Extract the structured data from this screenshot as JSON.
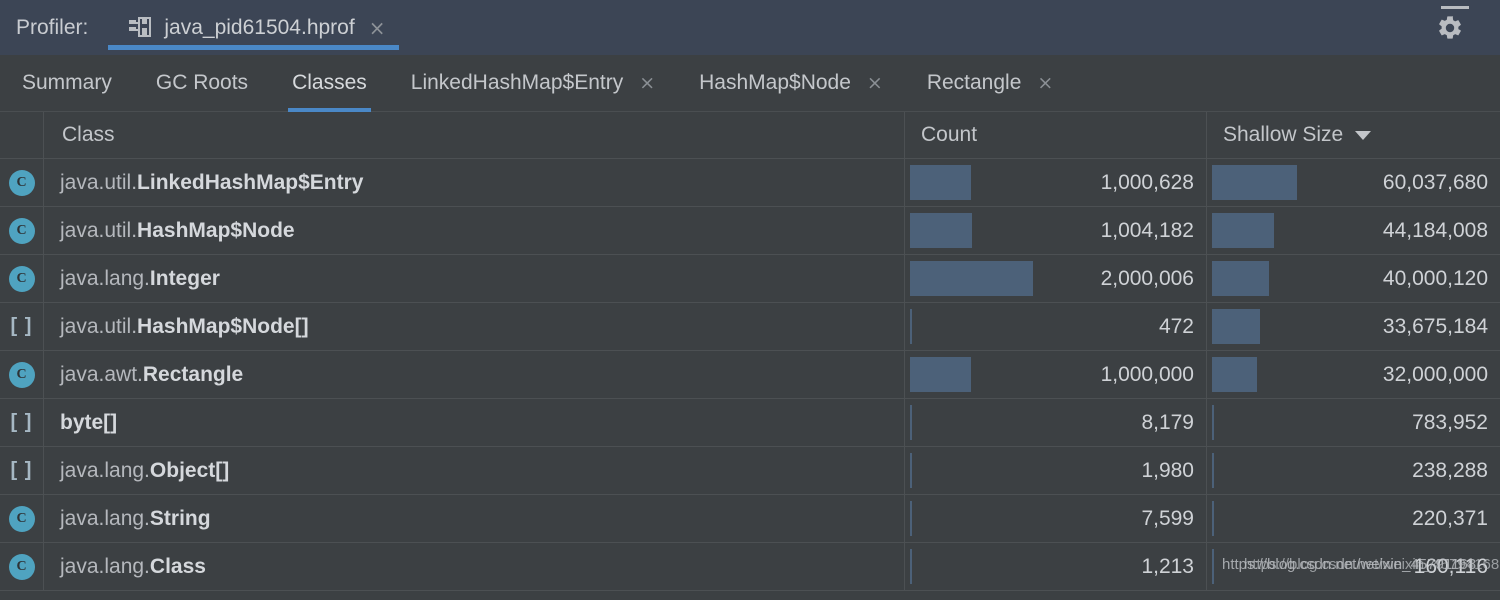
{
  "titlebar": {
    "profiler_label": "Profiler:",
    "file_tab": {
      "icon": "hprof-file-icon",
      "title": "java_pid61504.hprof",
      "close": "×"
    },
    "controls": {
      "settings_icon": "gear-icon",
      "minimize_icon": "minimize-icon"
    },
    "accent_color": "#4a88c7",
    "background_color": "#3c4555"
  },
  "tabs": [
    {
      "label": "Summary",
      "active": false,
      "closable": false,
      "close": ""
    },
    {
      "label": "GC Roots",
      "active": false,
      "closable": false,
      "close": ""
    },
    {
      "label": "Classes",
      "active": true,
      "closable": false,
      "close": ""
    },
    {
      "label": "LinkedHashMap$Entry",
      "active": false,
      "closable": true,
      "close": "×"
    },
    {
      "label": "HashMap$Node",
      "active": false,
      "closable": true,
      "close": "×"
    },
    {
      "label": "Rectangle",
      "active": false,
      "closable": true,
      "close": "×"
    }
  ],
  "table": {
    "columns": [
      {
        "key": "icon",
        "label": ""
      },
      {
        "key": "class",
        "label": "Class"
      },
      {
        "key": "count",
        "label": "Count"
      },
      {
        "key": "size",
        "label": "Shallow Size",
        "sorted": "desc",
        "caret": "▼"
      }
    ],
    "bar_color": "#4c6179",
    "rows": [
      {
        "icon": "class-icon",
        "icon_glyph": "C",
        "package": "java.util.",
        "simple": "LinkedHashMap$Entry",
        "count": "1,000,628",
        "count_value": 1000628,
        "count_bar_pct": 50.0,
        "size": "60,037,680",
        "size_value": 60037680,
        "size_bar_pct": 100.0
      },
      {
        "icon": "class-icon",
        "icon_glyph": "C",
        "package": "java.util.",
        "simple": "HashMap$Node",
        "count": "1,004,182",
        "count_value": 1004182,
        "count_bar_pct": 50.2,
        "size": "44,184,008",
        "size_value": 44184008,
        "size_bar_pct": 73.6
      },
      {
        "icon": "class-icon",
        "icon_glyph": "C",
        "package": "java.lang.",
        "simple": "Integer",
        "count": "2,000,006",
        "count_value": 2000006,
        "count_bar_pct": 100.0,
        "size": "40,000,120",
        "size_value": 40000120,
        "size_bar_pct": 66.6
      },
      {
        "icon": "array-icon",
        "icon_glyph": "[ ]",
        "package": "java.util.",
        "simple": "HashMap$Node[]",
        "count": "472",
        "count_value": 472,
        "count_bar_pct": 0.02,
        "size": "33,675,184",
        "size_value": 33675184,
        "size_bar_pct": 56.1
      },
      {
        "icon": "class-icon",
        "icon_glyph": "C",
        "package": "java.awt.",
        "simple": "Rectangle",
        "count": "1,000,000",
        "count_value": 1000000,
        "count_bar_pct": 50.0,
        "size": "32,000,000",
        "size_value": 32000000,
        "size_bar_pct": 53.3
      },
      {
        "icon": "array-icon",
        "icon_glyph": "[ ]",
        "package": "",
        "simple": "byte[]",
        "count": "8,179",
        "count_value": 8179,
        "count_bar_pct": 0.4,
        "size": "783,952",
        "size_value": 783952,
        "size_bar_pct": 1.3
      },
      {
        "icon": "array-icon",
        "icon_glyph": "[ ]",
        "package": "java.lang.",
        "simple": "Object[]",
        "count": "1,980",
        "count_value": 1980,
        "count_bar_pct": 0.1,
        "size": "238,288",
        "size_value": 238288,
        "size_bar_pct": 0.4
      },
      {
        "icon": "class-icon",
        "icon_glyph": "C",
        "package": "java.lang.",
        "simple": "String",
        "count": "7,599",
        "count_value": 7599,
        "count_bar_pct": 0.38,
        "size": "220,371",
        "size_value": 220371,
        "size_bar_pct": 0.37
      },
      {
        "icon": "class-icon",
        "icon_glyph": "C",
        "package": "java.lang.",
        "simple": "Class",
        "count": "1,213",
        "count_value": 1213,
        "count_bar_pct": 0.06,
        "size": "160,116",
        "size_value": 160116,
        "size_bar_pct": 0.27
      }
    ]
  },
  "watermark": {
    "line1": "https://blog.csdn.net/weixin_45791168",
    "line2": "https://blog.csdn.net/weixin_45794168"
  }
}
